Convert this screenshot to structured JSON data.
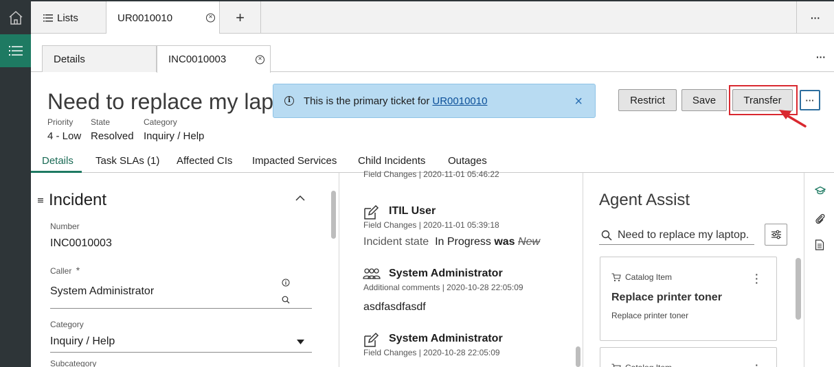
{
  "top_tabs": {
    "lists_label": "Lists",
    "active_label": "UR0010010",
    "add_label": "+",
    "more_label": "···"
  },
  "sub_tabs": {
    "details_label": "Details",
    "active_label": "INC0010003",
    "more_label": "···"
  },
  "record": {
    "title": "Need to replace my lapto",
    "priority_label": "Priority",
    "priority_value": "4 - Low",
    "state_label": "State",
    "state_value": "Resolved",
    "category_label": "Category",
    "category_value": "Inquiry / Help"
  },
  "banner": {
    "text": "This is the primary ticket for",
    "link": "UR0010010",
    "close": "×"
  },
  "actions": {
    "restrict": "Restrict",
    "save": "Save",
    "transfer": "Transfer",
    "more": "···"
  },
  "record_tabs": [
    "Details",
    "Task SLAs (1)",
    "Affected CIs",
    "Impacted Services",
    "Child Incidents",
    "Outages"
  ],
  "form": {
    "section_title": "Incident",
    "number_label": "Number",
    "number_value": "INC0010003",
    "caller_label": "Caller",
    "caller_required": "*",
    "caller_value": "System Administrator",
    "category_label": "Category",
    "category_value": "Inquiry / Help",
    "subcategory_label": "Subcategory"
  },
  "activity": [
    {
      "sub": "Field Changes | 2020-11-01 05:46:22"
    },
    {
      "name": "ITIL User",
      "sub": "Field Changes | 2020-11-01 05:39:18",
      "field": "Incident state",
      "new_value": "In Progress",
      "was": "was",
      "old_value": "New"
    },
    {
      "name": "System Administrator",
      "sub": "Additional comments | 2020-10-28 22:05:09",
      "body": "asdfasdfasdf"
    },
    {
      "name": "System Administrator",
      "sub": "Field Changes | 2020-10-28 22:05:09"
    }
  ],
  "agent_assist": {
    "title": "Agent Assist",
    "search_value": "Need to replace my laptop.",
    "cards": [
      {
        "type": "Catalog Item",
        "title": "Replace printer toner",
        "desc": "Replace printer toner"
      },
      {
        "type": "Catalog Item"
      }
    ]
  },
  "colors": {
    "rail": "#2e3538",
    "accent": "#1e7a62",
    "banner_bg": "#b8dbf2",
    "highlight": "#d9282f"
  }
}
